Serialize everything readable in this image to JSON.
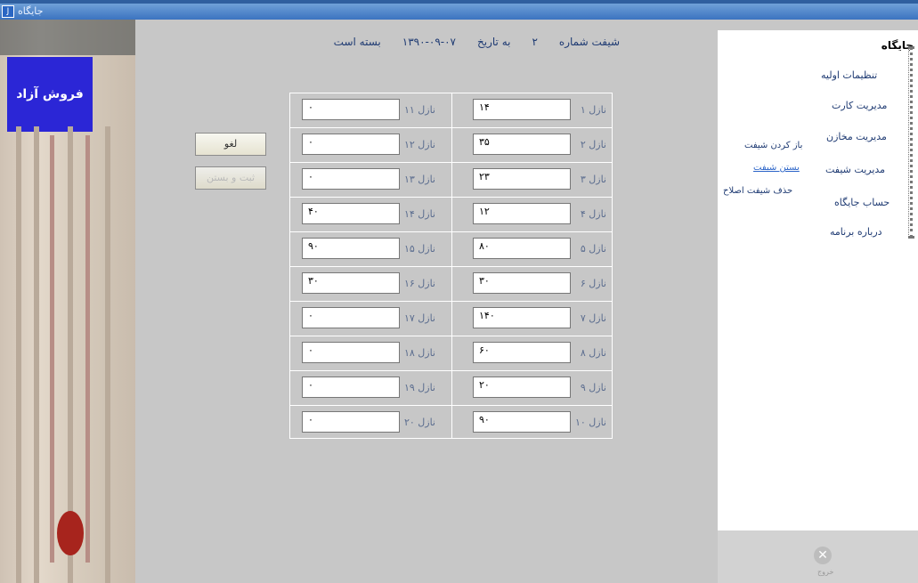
{
  "window": {
    "title": "جایگاه",
    "icon_label": "J"
  },
  "left_panel": {
    "image_text": "فروش آزاد"
  },
  "header": {
    "shift_label": "شیفت شماره",
    "shift_number": "۲",
    "date_label": "به تاریخ",
    "date_value": "۱۳۹۰-۰۹-۰۷",
    "status": "بسته است"
  },
  "nozzles": [
    {
      "label": "نازل ۱",
      "value": "۱۴"
    },
    {
      "label": "نازل ۲",
      "value": "۳۵"
    },
    {
      "label": "نازل ۳",
      "value": "۲۳"
    },
    {
      "label": "نازل ۴",
      "value": "۱۲"
    },
    {
      "label": "نازل ۵",
      "value": "۸۰"
    },
    {
      "label": "نازل ۶",
      "value": "۳۰"
    },
    {
      "label": "نازل ۷",
      "value": "۱۴۰"
    },
    {
      "label": "نازل ۸",
      "value": "۶۰"
    },
    {
      "label": "نازل ۹",
      "value": "۲۰"
    },
    {
      "label": "نازل ۱۰",
      "value": "۹۰"
    },
    {
      "label": "نازل ۱۱",
      "value": "۰"
    },
    {
      "label": "نازل ۱۲",
      "value": "۰"
    },
    {
      "label": "نازل ۱۳",
      "value": "۰"
    },
    {
      "label": "نازل ۱۴",
      "value": "۴۰"
    },
    {
      "label": "نازل ۱۵",
      "value": "۹۰"
    },
    {
      "label": "نازل ۱۶",
      "value": "۳۰"
    },
    {
      "label": "نازل ۱۷",
      "value": "۰"
    },
    {
      "label": "نازل ۱۸",
      "value": "۰"
    },
    {
      "label": "نازل ۱۹",
      "value": "۰"
    },
    {
      "label": "نازل ۲۰",
      "value": "۰"
    }
  ],
  "buttons": {
    "cancel": "لغو",
    "save": "ثبت و بستن"
  },
  "tree": {
    "root": "جایگاه",
    "items": [
      "تنظیمات اولیه",
      "مدیریت کارت",
      "مدیریت مخازن",
      "مدیریت شیفت",
      "حساب جایگاه",
      "درباره برنامه"
    ],
    "shift_sub": [
      "باز کردن شیفت",
      "بستن شیفت",
      "حذف شیفت اصلاح"
    ]
  },
  "footer": {
    "exit_label": "خروج"
  }
}
